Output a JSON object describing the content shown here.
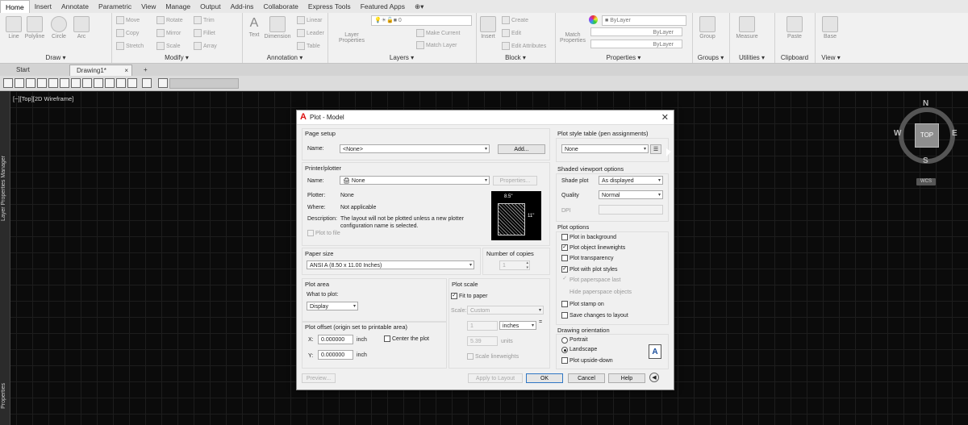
{
  "ribbon": {
    "tabs": [
      "Home",
      "Insert",
      "Annotate",
      "Parametric",
      "View",
      "Manage",
      "Output",
      "Add-ins",
      "Collaborate",
      "Express Tools",
      "Featured Apps"
    ],
    "panels": {
      "draw": "Draw ▾",
      "modify": "Modify ▾",
      "annotation": "Annotation ▾",
      "layers": "Layers ▾",
      "block": "Block ▾",
      "properties": "Properties ▾",
      "groups": "Groups ▾",
      "utilities": "Utilities ▾",
      "clipboard": "Clipboard",
      "view": "View ▾"
    },
    "draw_tools": [
      "Line",
      "Polyline",
      "Circle",
      "Arc"
    ],
    "modify_tools": [
      "Move",
      "Rotate",
      "Trim",
      "Copy",
      "Mirror",
      "Fillet",
      "Stretch",
      "Scale",
      "Array"
    ],
    "annotation_tools": [
      "Text",
      "Dimension",
      "Linear",
      "Leader",
      "Table"
    ],
    "layer_tools": [
      "Layer Properties",
      "Make Current",
      "Match Layer"
    ],
    "layer_value": "0",
    "block_tools": [
      "Insert",
      "Create",
      "Edit",
      "Edit Attributes"
    ],
    "match_properties": "Match Properties",
    "bylayer_values": [
      "ByLayer",
      "ByLayer",
      "ByLayer"
    ],
    "group_tool": "Group",
    "measure_tool": "Measure",
    "paste_tool": "Paste",
    "base_tool": "Base"
  },
  "file_tabs": [
    "Start",
    "Drawing1*"
  ],
  "canvas": {
    "view_label": "[−][Top][2D Wireframe]",
    "palette_labels": [
      "Layer Properties Manager",
      "Properties"
    ]
  },
  "viewcube": {
    "n": "N",
    "s": "S",
    "e": "E",
    "w": "W",
    "top": "TOP",
    "wcs": "WCS"
  },
  "dialog": {
    "title": "Plot - Model",
    "page_setup": {
      "label": "Page setup",
      "name_label": "Name:",
      "name_value": "<None>",
      "add_button": "Add..."
    },
    "printer": {
      "label": "Printer/plotter",
      "name_label": "Name:",
      "name_value": "None",
      "properties_button": "Properties...",
      "plotter_label": "Plotter:",
      "plotter_value": "None",
      "where_label": "Where:",
      "where_value": "Not applicable",
      "description_label": "Description:",
      "description_value_1": "The layout will not be plotted unless a new plotter",
      "description_value_2": "configuration name is selected.",
      "plot_to_file": "Plot to file",
      "preview_width": "8.5\"",
      "preview_height": "11\""
    },
    "paper_size": {
      "label": "Paper size",
      "value": "ANSI A (8.50 x 11.00 Inches)"
    },
    "copies": {
      "label": "Number of copies",
      "value": "1"
    },
    "plot_area": {
      "label": "Plot area",
      "what_label": "What to plot:",
      "what_value": "Display"
    },
    "plot_scale": {
      "label": "Plot scale",
      "fit_to_paper": "Fit to paper",
      "scale_label": "Scale:",
      "scale_value": "Custom",
      "value1": "1",
      "unit1": "inches",
      "value2": "5.39",
      "unit2": "units",
      "scale_lineweights": "Scale lineweights"
    },
    "plot_offset": {
      "label": "Plot offset (origin set to printable area)",
      "x_label": "X:",
      "x_value": "0.000000",
      "x_unit": "inch",
      "y_label": "Y:",
      "y_value": "0.000000",
      "y_unit": "inch",
      "center": "Center the plot"
    },
    "plot_style": {
      "label": "Plot style table (pen assignments)",
      "value": "None"
    },
    "shaded": {
      "label": "Shaded viewport options",
      "shade_label": "Shade plot",
      "shade_value": "As displayed",
      "quality_label": "Quality",
      "quality_value": "Normal",
      "dpi_label": "DPI"
    },
    "plot_options": {
      "label": "Plot options",
      "items": [
        {
          "label": "Plot in background",
          "checked": false,
          "disabled": false
        },
        {
          "label": "Plot object lineweights",
          "checked": true,
          "disabled": false
        },
        {
          "label": "Plot transparency",
          "checked": false,
          "disabled": false
        },
        {
          "label": "Plot with plot styles",
          "checked": true,
          "disabled": false
        },
        {
          "label": "Plot paperspace last",
          "checked": true,
          "disabled": true
        },
        {
          "label": "Hide paperspace objects",
          "checked": false,
          "disabled": true
        },
        {
          "label": "Plot stamp on",
          "checked": false,
          "disabled": false
        },
        {
          "label": "Save changes to layout",
          "checked": false,
          "disabled": false
        }
      ]
    },
    "orientation": {
      "label": "Drawing orientation",
      "portrait": "Portrait",
      "landscape": "Landscape",
      "upside_down": "Plot upside-down"
    },
    "buttons": {
      "preview": "Preview...",
      "apply": "Apply to Layout",
      "ok": "OK",
      "cancel": "Cancel",
      "help": "Help"
    }
  }
}
